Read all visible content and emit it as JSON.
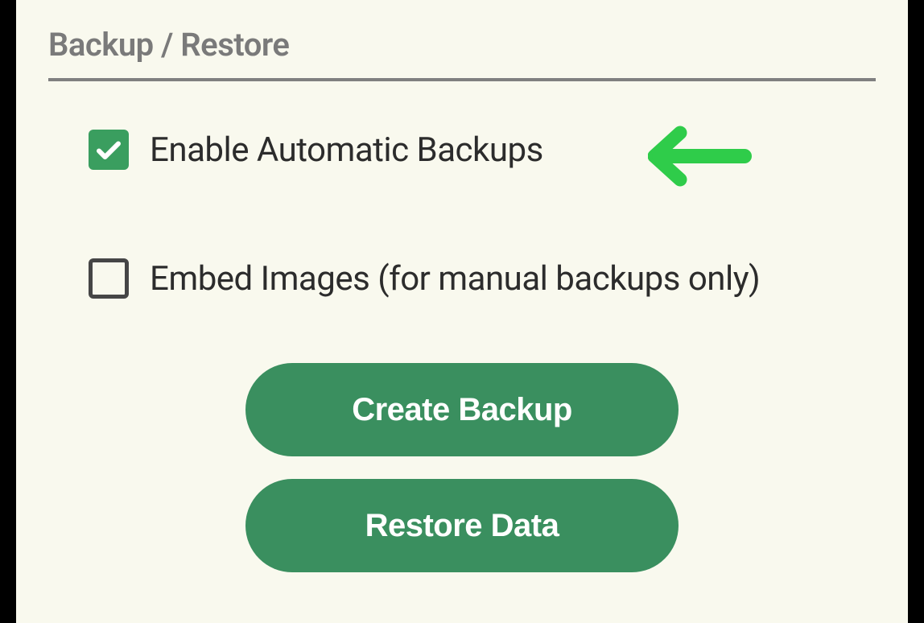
{
  "section": {
    "title": "Backup / Restore"
  },
  "options": {
    "automatic_backups": {
      "label": "Enable Automatic Backups",
      "checked": true
    },
    "embed_images": {
      "label": "Embed Images (for manual backups only)",
      "checked": false
    }
  },
  "buttons": {
    "create_backup": "Create Backup",
    "restore_data": "Restore Data"
  },
  "colors": {
    "accent_green": "#3a9e5f",
    "button_green": "#3a8f5f",
    "arrow_green": "#2fcc4a",
    "panel_bg": "#f9f9ee",
    "title_gray": "#7a7a7a",
    "text_dark": "#2c2c2c"
  }
}
